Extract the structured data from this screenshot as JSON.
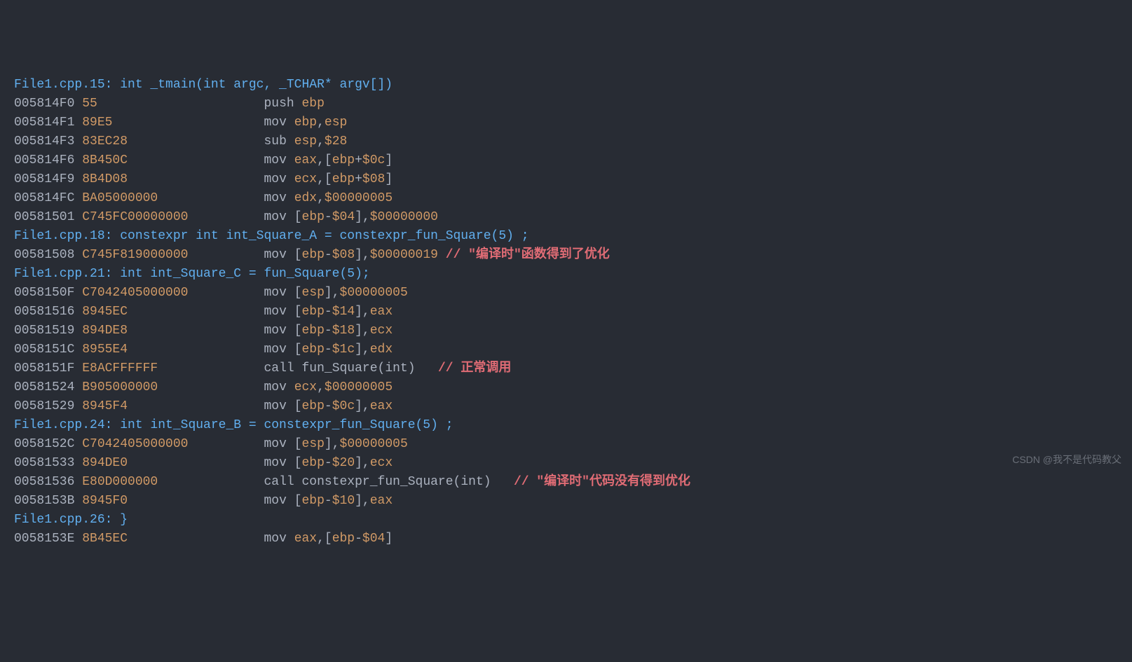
{
  "watermark": "CSDN @我不是代码教父",
  "comments": {
    "c1": "// \"编译时\"函数得到了优化",
    "c2": "// 正常调用",
    "c3": "// \"编译时\"代码没有得到优化"
  },
  "lines": [
    {
      "type": "source",
      "text": "File1.cpp.15: int _tmain(int argc, _TCHAR* argv[])"
    },
    {
      "type": "asm",
      "addr": "005814F0",
      "hex": "55",
      "inst": "push ",
      "ops": [
        {
          "t": "reg",
          "v": "ebp"
        }
      ]
    },
    {
      "type": "asm",
      "addr": "005814F1",
      "hex": "89E5",
      "inst": "mov ",
      "ops": [
        {
          "t": "reg",
          "v": "ebp"
        },
        {
          "t": "p",
          "v": ","
        },
        {
          "t": "reg",
          "v": "esp"
        }
      ]
    },
    {
      "type": "asm",
      "addr": "005814F3",
      "hex": "83EC28",
      "inst": "sub ",
      "ops": [
        {
          "t": "reg",
          "v": "esp"
        },
        {
          "t": "p",
          "v": ","
        },
        {
          "t": "imm",
          "v": "$28"
        }
      ]
    },
    {
      "type": "asm",
      "addr": "005814F6",
      "hex": "8B450C",
      "inst": "mov ",
      "ops": [
        {
          "t": "reg",
          "v": "eax"
        },
        {
          "t": "p",
          "v": ",["
        },
        {
          "t": "reg",
          "v": "ebp"
        },
        {
          "t": "p",
          "v": "+"
        },
        {
          "t": "imm",
          "v": "$0c"
        },
        {
          "t": "p",
          "v": "]"
        }
      ]
    },
    {
      "type": "asm",
      "addr": "005814F9",
      "hex": "8B4D08",
      "inst": "mov ",
      "ops": [
        {
          "t": "reg",
          "v": "ecx"
        },
        {
          "t": "p",
          "v": ",["
        },
        {
          "t": "reg",
          "v": "ebp"
        },
        {
          "t": "p",
          "v": "+"
        },
        {
          "t": "imm",
          "v": "$08"
        },
        {
          "t": "p",
          "v": "]"
        }
      ]
    },
    {
      "type": "asm",
      "addr": "005814FC",
      "hex": "BA05000000",
      "inst": "mov ",
      "ops": [
        {
          "t": "reg",
          "v": "edx"
        },
        {
          "t": "p",
          "v": ","
        },
        {
          "t": "imm",
          "v": "$00000005"
        }
      ]
    },
    {
      "type": "asm",
      "addr": "00581501",
      "hex": "C745FC00000000",
      "inst": "mov ",
      "ops": [
        {
          "t": "p",
          "v": "["
        },
        {
          "t": "reg",
          "v": "ebp"
        },
        {
          "t": "p",
          "v": "-"
        },
        {
          "t": "imm",
          "v": "$04"
        },
        {
          "t": "p",
          "v": "],"
        },
        {
          "t": "imm",
          "v": "$00000000"
        }
      ]
    },
    {
      "type": "source",
      "text": "File1.cpp.18: constexpr int int_Square_A = constexpr_fun_Square(5) ;"
    },
    {
      "type": "asm",
      "addr": "00581508",
      "hex": "C745F819000000",
      "inst": "mov ",
      "ops": [
        {
          "t": "p",
          "v": "["
        },
        {
          "t": "reg",
          "v": "ebp"
        },
        {
          "t": "p",
          "v": "-"
        },
        {
          "t": "imm",
          "v": "$08"
        },
        {
          "t": "p",
          "v": "],"
        },
        {
          "t": "imm",
          "v": "$00000019"
        }
      ],
      "comment": "c1",
      "bp": true
    },
    {
      "type": "source",
      "text": "File1.cpp.21: int int_Square_C = fun_Square(5);"
    },
    {
      "type": "asm",
      "addr": "0058150F",
      "hex": "C7042405000000",
      "inst": "mov ",
      "ops": [
        {
          "t": "p",
          "v": "["
        },
        {
          "t": "reg",
          "v": "esp"
        },
        {
          "t": "p",
          "v": "],"
        },
        {
          "t": "imm",
          "v": "$00000005"
        }
      ]
    },
    {
      "type": "asm",
      "addr": "00581516",
      "hex": "8945EC",
      "inst": "mov ",
      "ops": [
        {
          "t": "p",
          "v": "["
        },
        {
          "t": "reg",
          "v": "ebp"
        },
        {
          "t": "p",
          "v": "-"
        },
        {
          "t": "imm",
          "v": "$14"
        },
        {
          "t": "p",
          "v": "],"
        },
        {
          "t": "reg",
          "v": "eax"
        }
      ]
    },
    {
      "type": "asm",
      "addr": "00581519",
      "hex": "894DE8",
      "inst": "mov ",
      "ops": [
        {
          "t": "p",
          "v": "["
        },
        {
          "t": "reg",
          "v": "ebp"
        },
        {
          "t": "p",
          "v": "-"
        },
        {
          "t": "imm",
          "v": "$18"
        },
        {
          "t": "p",
          "v": "],"
        },
        {
          "t": "reg",
          "v": "ecx"
        }
      ]
    },
    {
      "type": "asm",
      "addr": "0058151C",
      "hex": "8955E4",
      "inst": "mov ",
      "ops": [
        {
          "t": "p",
          "v": "["
        },
        {
          "t": "reg",
          "v": "ebp"
        },
        {
          "t": "p",
          "v": "-"
        },
        {
          "t": "imm",
          "v": "$1c"
        },
        {
          "t": "p",
          "v": "],"
        },
        {
          "t": "reg",
          "v": "edx"
        }
      ]
    },
    {
      "type": "asm",
      "addr": "0058151F",
      "hex": "E8ACFFFFFF",
      "inst": "call ",
      "ops": [
        {
          "t": "p",
          "v": "fun_Square(int)"
        }
      ],
      "comment": "c2",
      "gap": "   "
    },
    {
      "type": "asm",
      "addr": "00581524",
      "hex": "B905000000",
      "inst": "mov ",
      "ops": [
        {
          "t": "reg",
          "v": "ecx"
        },
        {
          "t": "p",
          "v": ","
        },
        {
          "t": "imm",
          "v": "$00000005"
        }
      ]
    },
    {
      "type": "asm",
      "addr": "00581529",
      "hex": "8945F4",
      "inst": "mov ",
      "ops": [
        {
          "t": "p",
          "v": "["
        },
        {
          "t": "reg",
          "v": "ebp"
        },
        {
          "t": "p",
          "v": "-"
        },
        {
          "t": "imm",
          "v": "$0c"
        },
        {
          "t": "p",
          "v": "],"
        },
        {
          "t": "reg",
          "v": "eax"
        }
      ]
    },
    {
      "type": "source",
      "text": "File1.cpp.24: int int_Square_B = constexpr_fun_Square(5) ;"
    },
    {
      "type": "asm",
      "addr": "0058152C",
      "hex": "C7042405000000",
      "inst": "mov ",
      "ops": [
        {
          "t": "p",
          "v": "["
        },
        {
          "t": "reg",
          "v": "esp"
        },
        {
          "t": "p",
          "v": "],"
        },
        {
          "t": "imm",
          "v": "$00000005"
        }
      ]
    },
    {
      "type": "asm",
      "addr": "00581533",
      "hex": "894DE0",
      "inst": "mov ",
      "ops": [
        {
          "t": "p",
          "v": "["
        },
        {
          "t": "reg",
          "v": "ebp"
        },
        {
          "t": "p",
          "v": "-"
        },
        {
          "t": "imm",
          "v": "$20"
        },
        {
          "t": "p",
          "v": "],"
        },
        {
          "t": "reg",
          "v": "ecx"
        }
      ]
    },
    {
      "type": "asm",
      "addr": "00581536",
      "hex": "E80D000000",
      "inst": "call ",
      "ops": [
        {
          "t": "p",
          "v": "constexpr_fun_Square(int)"
        }
      ],
      "comment": "c3",
      "gap": "   "
    },
    {
      "type": "asm",
      "addr": "0058153B",
      "hex": "8945F0",
      "inst": "mov ",
      "ops": [
        {
          "t": "p",
          "v": "["
        },
        {
          "t": "reg",
          "v": "ebp"
        },
        {
          "t": "p",
          "v": "-"
        },
        {
          "t": "imm",
          "v": "$10"
        },
        {
          "t": "p",
          "v": "],"
        },
        {
          "t": "reg",
          "v": "eax"
        }
      ]
    },
    {
      "type": "source",
      "text": "File1.cpp.26: }"
    },
    {
      "type": "asm",
      "addr": "0058153E",
      "hex": "8B45EC",
      "inst": "mov ",
      "ops": [
        {
          "t": "reg",
          "v": "eax"
        },
        {
          "t": "p",
          "v": ",["
        },
        {
          "t": "reg",
          "v": "ebp"
        },
        {
          "t": "p",
          "v": "-"
        },
        {
          "t": "imm",
          "v": "$04"
        },
        {
          "t": "p",
          "v": "]"
        }
      ],
      "cut": true
    }
  ]
}
